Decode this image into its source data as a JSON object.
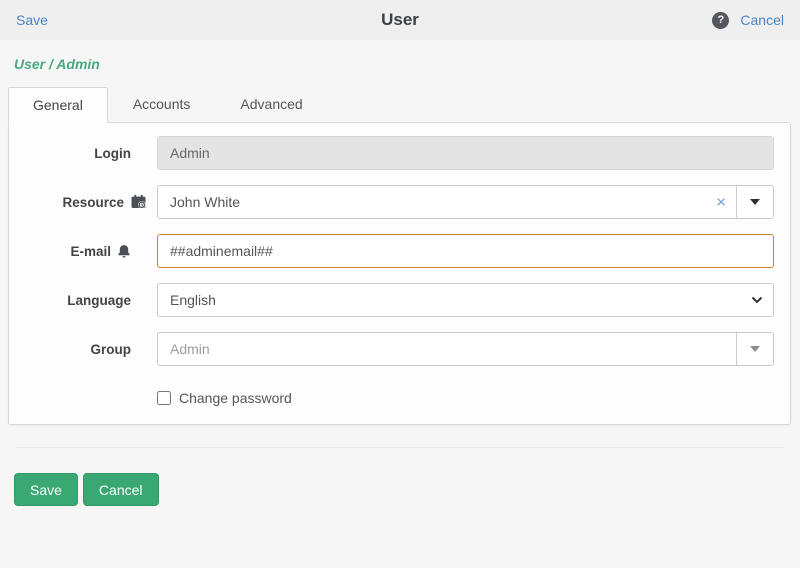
{
  "header": {
    "save": "Save",
    "title": "User",
    "cancel": "Cancel",
    "help": "?"
  },
  "breadcrumb": "User / Admin",
  "tabs": [
    {
      "label": "General",
      "active": true
    },
    {
      "label": "Accounts",
      "active": false
    },
    {
      "label": "Advanced",
      "active": false
    }
  ],
  "form": {
    "login": {
      "label": "Login",
      "value": "Admin"
    },
    "resource": {
      "label": "Resource",
      "value": "John White",
      "clear": "×",
      "icon": "calendar-clock-icon"
    },
    "email": {
      "label": "E-mail",
      "value": "##adminemail##",
      "icon": "bell-icon"
    },
    "language": {
      "label": "Language",
      "value": "English"
    },
    "group": {
      "label": "Group",
      "placeholder": "Admin"
    },
    "change_password": {
      "label": "Change password",
      "checked": false
    }
  },
  "footer": {
    "save": "Save",
    "cancel": "Cancel"
  },
  "colors": {
    "link_blue": "#4a86c6",
    "breadcrumb_green": "#4ba87e",
    "button_green": "#3aa873",
    "email_border_orange": "#c8832c"
  }
}
